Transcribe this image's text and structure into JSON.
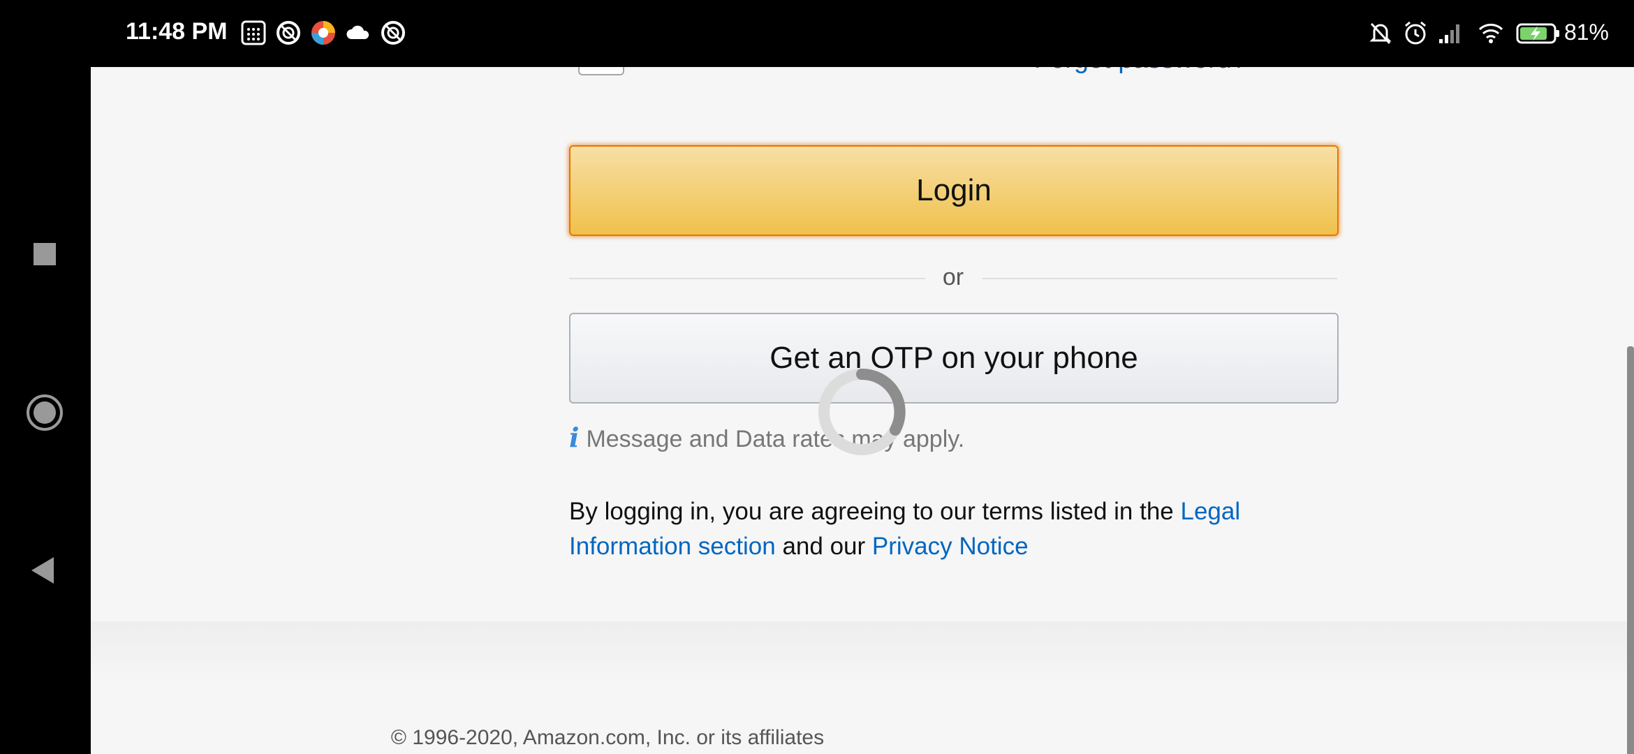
{
  "status_bar": {
    "time": "11:48 PM",
    "battery": "81%",
    "icons": [
      "calculator-icon",
      "target-icon",
      "browser-icon",
      "cloud-icon",
      "target-icon",
      "bell-off-icon",
      "alarm-icon",
      "signal-icon",
      "wifi-icon",
      "battery-charging-icon"
    ]
  },
  "nav": {
    "buttons": [
      "recent-apps-icon",
      "home-icon",
      "back-icon"
    ]
  },
  "form": {
    "forgot_password_partial": "Forgot password?",
    "login_label": "Login",
    "divider_text": "or",
    "otp_label": "Get an OTP on your phone",
    "info_text": "Message and Data rates may apply.",
    "info_icon": "i",
    "legal_prefix": "By logging in, you are agreeing to our terms listed in the ",
    "legal_link1": "Legal Information section",
    "legal_middle": " and our ",
    "legal_link2": "Privacy Notice"
  },
  "footer": {
    "copyright": "© 1996-2020, Amazon.com, Inc. or its affiliates"
  },
  "colors": {
    "login_top": "#f7dfa5",
    "login_bottom": "#f0c14b",
    "login_border": "#e77600",
    "link": "#0066c0",
    "info_icon": "#3b8ad9",
    "battery_green": "#7bd36b"
  }
}
